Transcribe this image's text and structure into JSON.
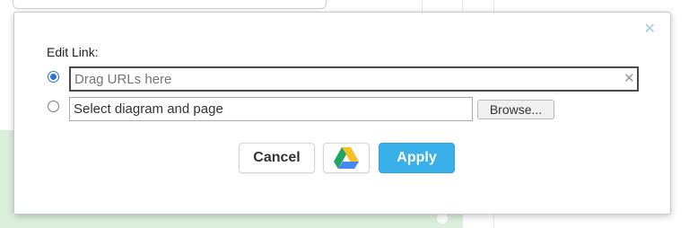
{
  "dialog": {
    "title": "Edit Link:",
    "close_icon": "close-icon",
    "options": {
      "url": {
        "selected": true,
        "placeholder": "Drag URLs here",
        "value": ""
      },
      "page": {
        "selected": false,
        "placeholder": "Select diagram and page",
        "value": ""
      }
    },
    "browse_label": "Browse...",
    "cancel_label": "Cancel",
    "drive_icon": "google-drive-icon",
    "apply_label": "Apply"
  },
  "colors": {
    "apply": "#3ab0ea",
    "radio_selected": "#2d74d6",
    "background_accent": "#dcefdc"
  }
}
